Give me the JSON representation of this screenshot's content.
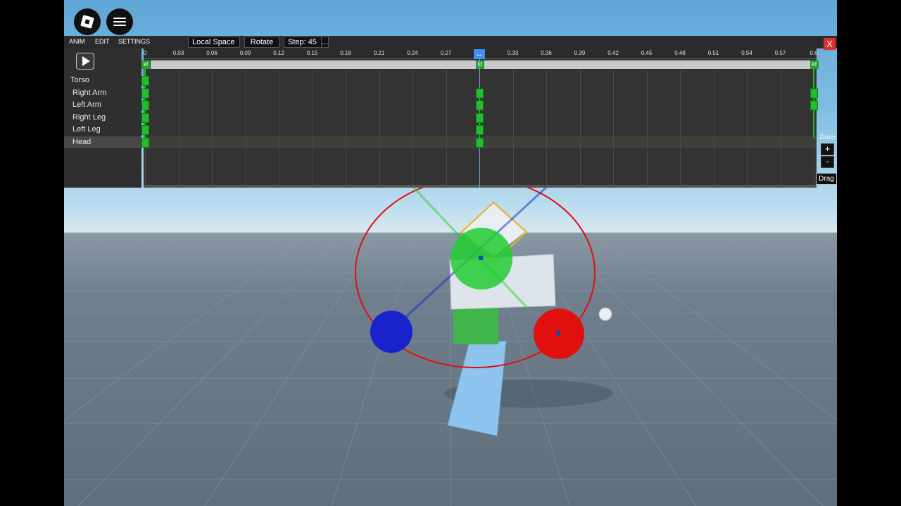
{
  "menu": {
    "anim": "ANIM",
    "edit": "EDIT",
    "settings": "SETTINGS"
  },
  "toolbar": {
    "space": "Local Space",
    "mode": "Rotate",
    "step": "Step: 45",
    "more": "..."
  },
  "close_label": "X",
  "timeline": {
    "ticks": [
      "0",
      "0.03",
      "0.06",
      "0.09",
      "0.12",
      "0.15",
      "0.18",
      "0.21",
      "0.24",
      "0.27",
      "0.3",
      "0.33",
      "0.36",
      "0.39",
      "0.42",
      "0.45",
      "0.48",
      "0.51",
      "0.54",
      "0.57",
      "0.6"
    ],
    "playhead_time": 0.3,
    "playhead_label": "↔",
    "keyframe_marker": "kf",
    "end_time": 0.6
  },
  "limbs": [
    {
      "label": "Torso",
      "selected": false
    },
    {
      "label": "Right Arm",
      "selected": false
    },
    {
      "label": "Left Arm",
      "selected": false
    },
    {
      "label": "Right Leg",
      "selected": false
    },
    {
      "label": "Left Leg",
      "selected": false
    },
    {
      "label": "Head",
      "selected": true
    }
  ],
  "keyframes": {
    "Torso": [
      0
    ],
    "Right Arm": [
      0,
      0.3,
      0.6
    ],
    "Left Arm": [
      0,
      0.3,
      0.6
    ],
    "Right Leg": [
      0,
      0.3
    ],
    "Left Leg": [
      0,
      0.3
    ],
    "Head": [
      0,
      0.3
    ]
  },
  "zoom": {
    "label": "Zoom",
    "plus": "+",
    "minus": "-"
  },
  "drag_label": "Drag",
  "colors": {
    "keyframe": "#1fbf2b",
    "playhead": "#3b8ff1",
    "close": "#d9312b",
    "gizmo_x": "#e01010",
    "gizmo_y": "#22cc33",
    "gizmo_z": "#1a22cc"
  }
}
